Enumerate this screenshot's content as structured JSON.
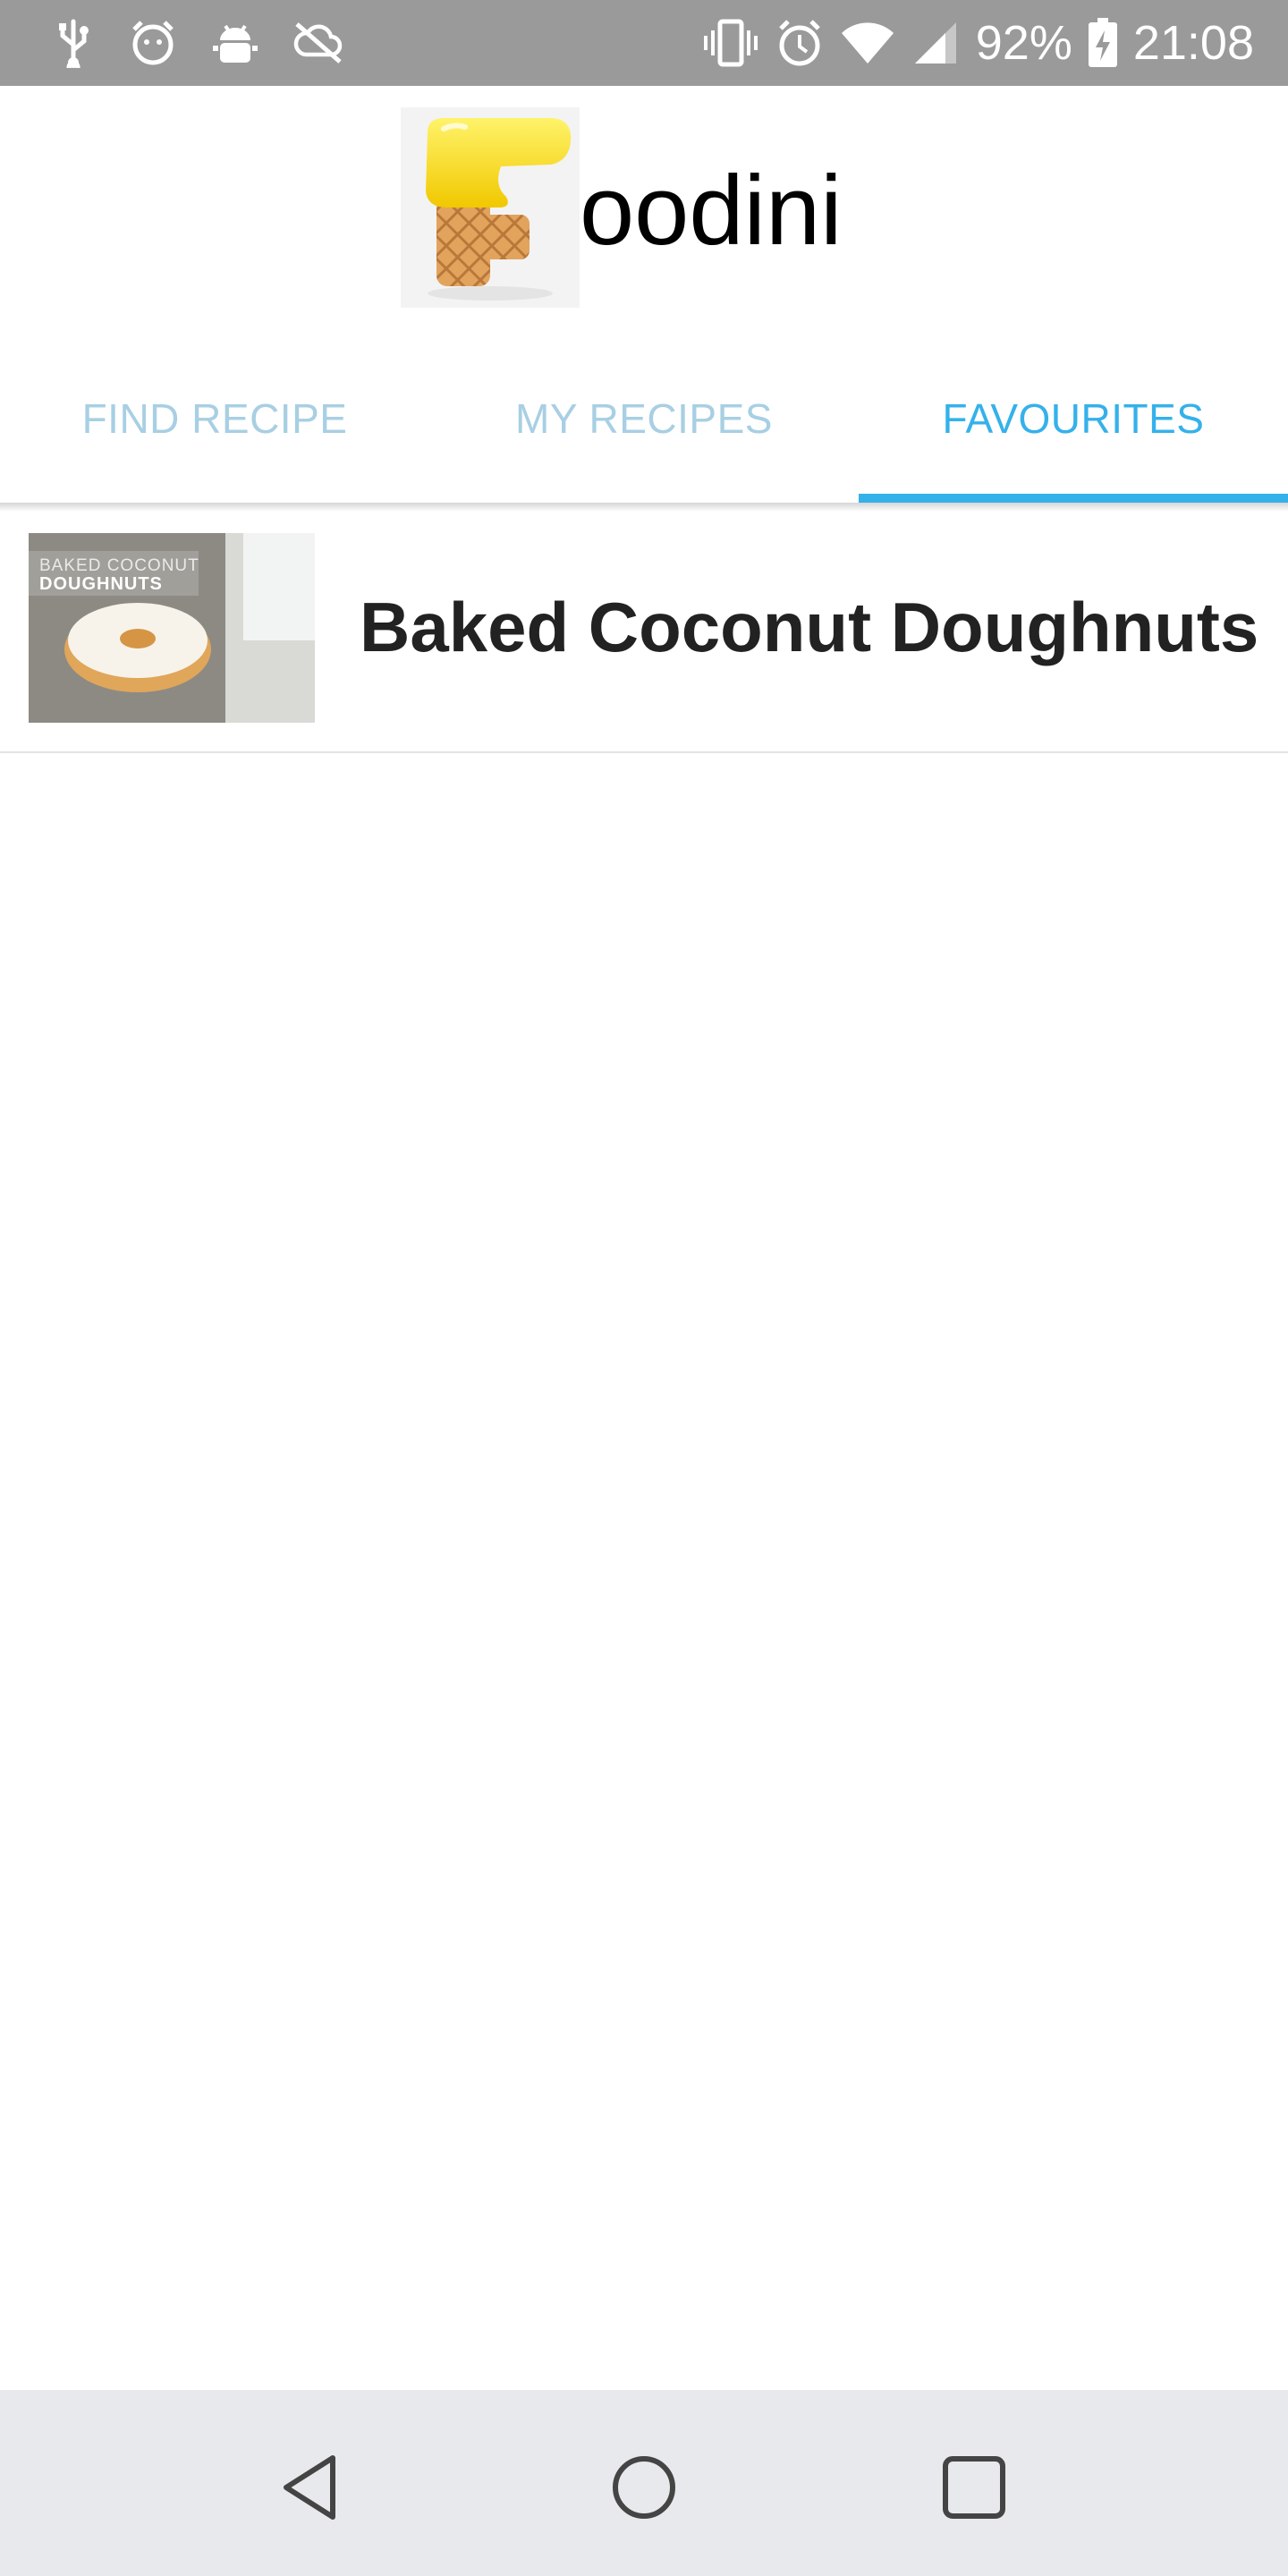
{
  "status_bar": {
    "battery": "92%",
    "time": "21:08",
    "left_icons": [
      "usb-icon",
      "alarm-face-icon",
      "android-debug-icon",
      "no-sync-icon"
    ],
    "right_icons": [
      "vibrate-icon",
      "alarm-icon",
      "wifi-icon",
      "signal-icon",
      "battery-charging-icon"
    ]
  },
  "app": {
    "title": "oodini",
    "logo_icon": "waffle-f-logo"
  },
  "tabs": [
    {
      "label": "FIND RECIPE",
      "active": false
    },
    {
      "label": "MY RECIPES",
      "active": false
    },
    {
      "label": "FAVOURITES",
      "active": true
    }
  ],
  "colors": {
    "accent": "#35b1ea",
    "inactive_tab": "#a8cfe3",
    "status_bar": "#9a9a9a",
    "nav_bar": "#e8e9ec"
  },
  "favourites": [
    {
      "title": "Baked Coconut Doughnuts",
      "thumb_line1": "BAKED COCONUT",
      "thumb_line2": "DOUGHNUTS"
    }
  ],
  "nav": {
    "buttons": [
      "back-icon",
      "home-icon",
      "recents-icon"
    ]
  }
}
